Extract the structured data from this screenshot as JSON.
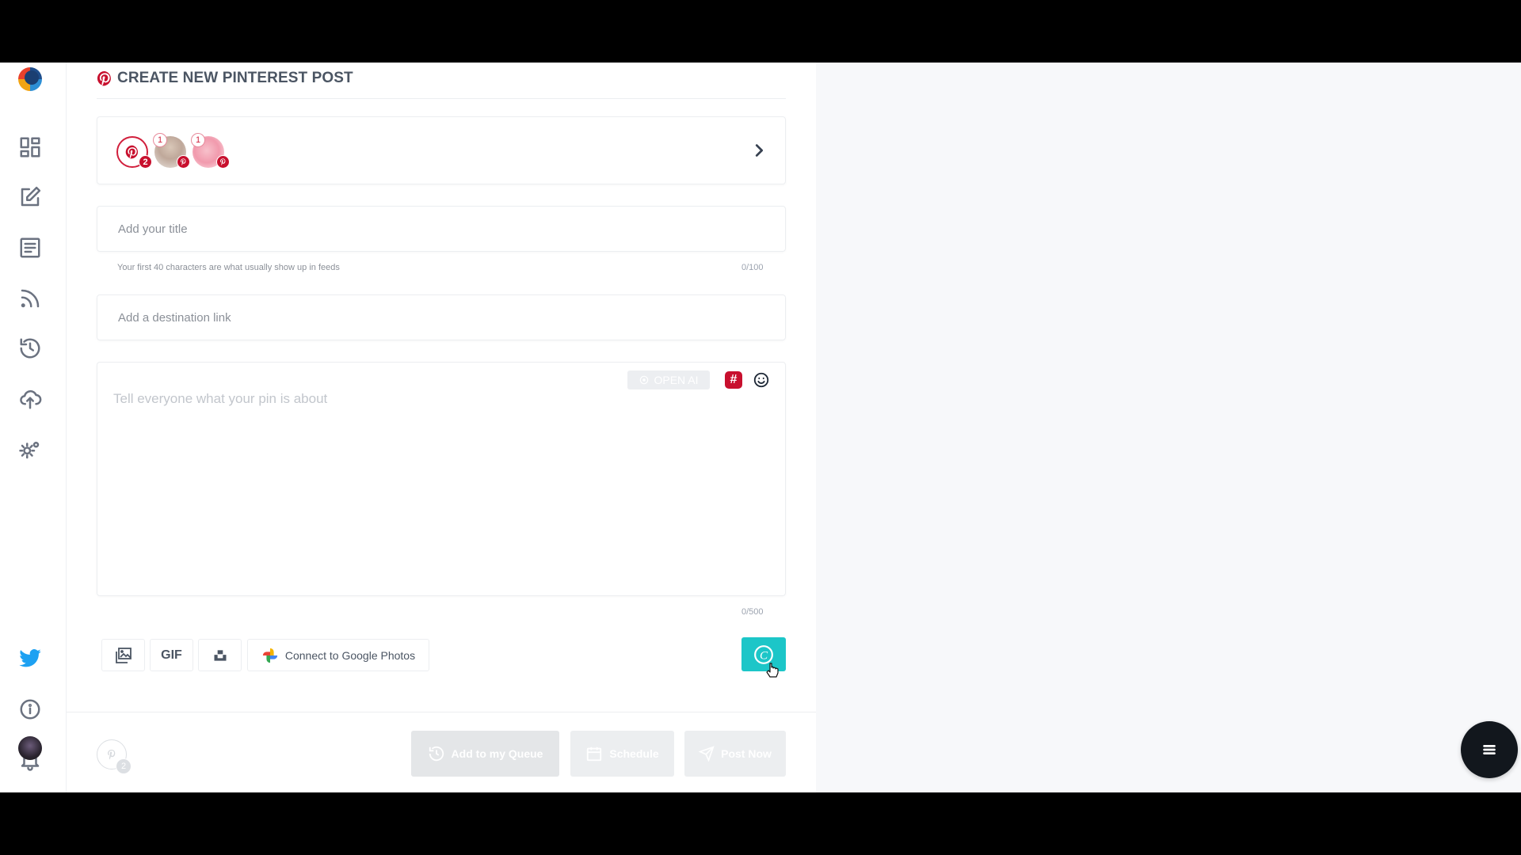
{
  "header": {
    "title": "CREATE NEW PINTEREST POST"
  },
  "sidebar": {
    "items": [
      {
        "icon": "dashboard-icon"
      },
      {
        "icon": "compose-icon"
      },
      {
        "icon": "posts-list-icon"
      },
      {
        "icon": "rss-feed-icon"
      },
      {
        "icon": "history-icon"
      },
      {
        "icon": "cloud-upload-icon"
      },
      {
        "icon": "settings-icon"
      },
      {
        "icon": "twitter-icon"
      },
      {
        "icon": "info-icon"
      },
      {
        "icon": "bell-icon"
      },
      {
        "icon": "user-avatar"
      }
    ]
  },
  "accounts": {
    "group_count": "2",
    "account_1_num": "1",
    "account_2_num": "1"
  },
  "title_field": {
    "placeholder": "Add your title",
    "helper": "Your first 40 characters are what usually show up in feeds",
    "counter": "0/100"
  },
  "link_field": {
    "placeholder": "Add a destination link"
  },
  "description": {
    "placeholder": "Tell everyone what your pin is about",
    "openai_label": "OPEN AI",
    "hashtag_label": "#",
    "counter": "0/500"
  },
  "toolbar": {
    "gif_label": "GIF",
    "google_photos_label": "Connect to Google Photos",
    "canva_label": "C"
  },
  "footer": {
    "selected_count": "2",
    "queue_label": "Add to my Queue",
    "schedule_label": "Schedule",
    "post_now_label": "Post Now"
  },
  "colors": {
    "pinterest_red": "#c8102e",
    "canva_teal": "#1cc6c8",
    "fab_dark": "#12171d"
  }
}
